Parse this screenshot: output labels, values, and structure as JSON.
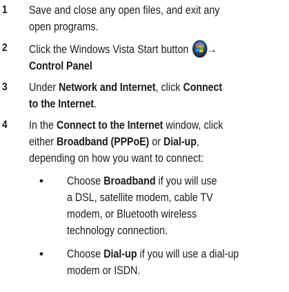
{
  "steps": [
    {
      "number": "1",
      "lines": [
        "Save and close any open files, and exit any",
        "open programs."
      ]
    },
    {
      "number": "2",
      "line1": "Click the Windows Vista Start button",
      "arrow": "→",
      "line2_bold": "Control Panel",
      "icon": "windows-vista-start-orb-icon"
    },
    {
      "number": "3",
      "line1_pre": "Under ",
      "line1_bold1": "Network and Internet",
      "line1_mid": ", click ",
      "line1_bold2": "Connect",
      "line2_bold": "to the Internet",
      "line2_post": "."
    },
    {
      "number": "4",
      "line1_pre": "In the ",
      "line1_bold": "Connect to the Internet",
      "line1_post": " window, click",
      "line2_pre": "either ",
      "line2_bold1": "Broadband (PPPoE)",
      "line2_mid": " or ",
      "line2_bold2": "Dial-up",
      "line2_post": ",",
      "line3": "depending on how you want to connect:",
      "bullets": [
        {
          "symbol": "•",
          "pre": "Choose ",
          "bold": "Broadband",
          "line1_post": " if you will use",
          "rest": [
            "a DSL, satellite modem, cable TV",
            "modem, or Bluetooth wireless",
            "technology connection."
          ]
        },
        {
          "symbol": "•",
          "pre": "Choose ",
          "bold": "Dial-up",
          "line1_post": " if you will use a dial-up",
          "rest": [
            "modem or ISDN."
          ]
        }
      ]
    }
  ]
}
